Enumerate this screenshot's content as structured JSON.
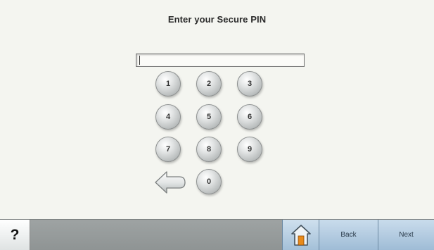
{
  "header": {
    "title": "Enter your Secure PIN"
  },
  "pin_field": {
    "value": "",
    "placeholder": ""
  },
  "keypad": {
    "keys": [
      "1",
      "2",
      "3",
      "4",
      "5",
      "6",
      "7",
      "8",
      "9",
      "0"
    ],
    "backspace_icon": "backspace-arrow-icon"
  },
  "footer": {
    "help_label": "?",
    "home_icon": "home-icon",
    "back_label": "Back",
    "next_label": "Next"
  },
  "colors": {
    "background": "#f4f5f0",
    "footer_bar": "#979c9c",
    "nav_button": "#b4cde2",
    "home_door": "#e88a1a"
  }
}
